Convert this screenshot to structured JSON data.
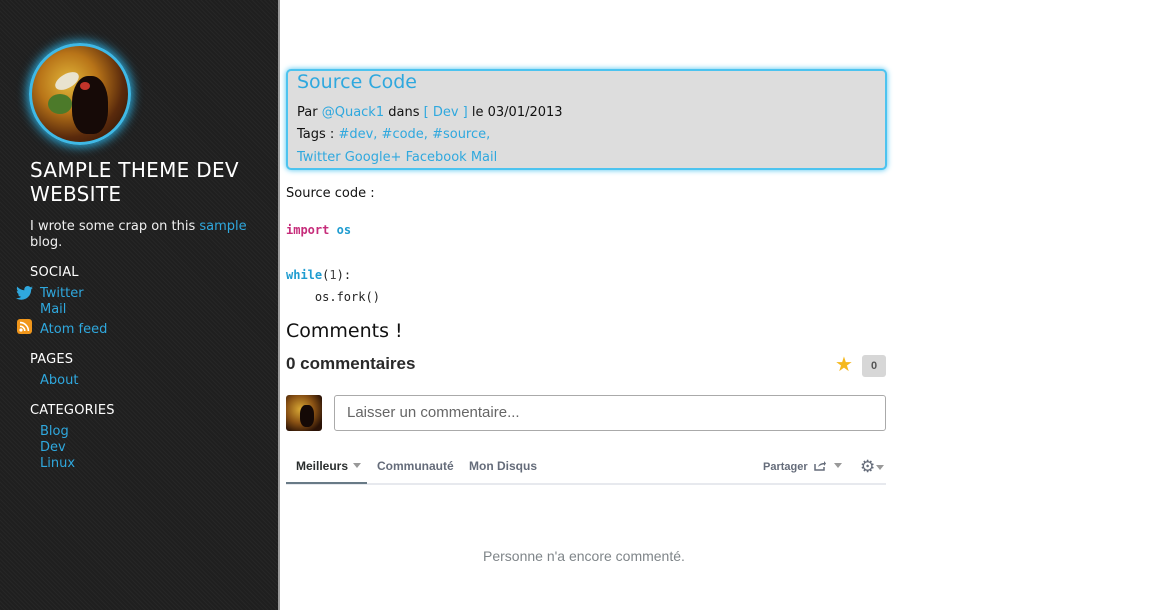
{
  "sidebar": {
    "site_title": "SAMPLE THEME DEV WEBSITE",
    "description_prefix": "I wrote some crap on this",
    "description_link": "sample",
    "description_suffix": "blog.",
    "social_heading": "SOCIAL",
    "social_links": [
      {
        "label": "Twitter",
        "icon": "twitter-icon"
      },
      {
        "label": "Mail"
      },
      {
        "label": "Atom feed",
        "icon": "rss-icon"
      }
    ],
    "pages_heading": "PAGES",
    "pages": [
      "About"
    ],
    "categories_heading": "CATEGORIES",
    "categories": [
      "Blog",
      "Dev",
      "Linux"
    ]
  },
  "post": {
    "title": "Source Code",
    "by_label": "Par",
    "author": "@Quack1",
    "in_label": "dans",
    "category": "[ Dev ]",
    "date_label": "le 03/01/2013",
    "tags_label": "Tags :",
    "tags": [
      "#dev,",
      "#code,",
      "#source,"
    ],
    "share_links": [
      "Twitter",
      "Google+",
      "Facebook",
      "Mail"
    ],
    "body_intro": "Source code :",
    "code_lines": [
      {
        "kw": "import",
        "rest": "os"
      },
      {
        "kw": "while",
        "paren_open": "(",
        "num": "1",
        "paren_close": "):"
      },
      {
        "text": "    os.fork()"
      }
    ]
  },
  "comments": {
    "heading": "Comments !",
    "count_label": "0 commentaires",
    "star_icon": "star-icon",
    "star_count": "0",
    "input_placeholder": "Laisser un commentaire...",
    "tabs": [
      "Meilleurs",
      "Communauté",
      "Mon Disqus"
    ],
    "share_label": "Partager",
    "empty_message": "Personne n'a encore commenté."
  },
  "colors": {
    "accent": "#2fa8de",
    "sidebar_bg": "#1f1f1f",
    "header_border": "#4cc3ef"
  }
}
